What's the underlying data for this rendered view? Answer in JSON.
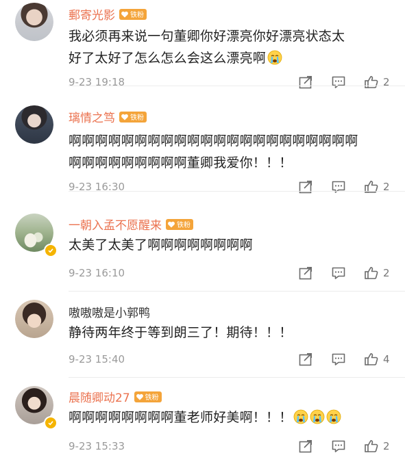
{
  "fan_badge_label": "铁粉",
  "comments": [
    {
      "username": "郵寄光影",
      "has_badge": true,
      "lines": [
        "我必须再来说一句董卿你好漂亮你好漂亮状态太",
        "好了太好了怎么怎么会这么漂亮啊"
      ],
      "emoji": [
        "crying-face-icon"
      ],
      "timestamp": "9-23 19:18",
      "likes": "2"
    },
    {
      "username": "璃情之笃",
      "has_badge": true,
      "lines": [
        "啊啊啊啊啊啊啊啊啊啊啊啊啊啊啊啊啊啊啊啊啊啊",
        "啊啊啊啊啊啊啊啊啊董卿我爱你！！！"
      ],
      "emoji": [],
      "timestamp": "9-23 16:30",
      "likes": "2"
    },
    {
      "username": "一朝入孟不愿醒来",
      "has_badge": true,
      "lines": [
        "太美了太美了啊啊啊啊啊啊啊啊"
      ],
      "emoji": [],
      "timestamp": "9-23 16:10",
      "likes": "2"
    },
    {
      "username": "嗷嗷嗷是小郭鸭",
      "has_badge": false,
      "lines": [
        "静待两年终于等到朗三了！期待！！！"
      ],
      "emoji": [],
      "timestamp": "9-23 15:40",
      "likes": "4"
    },
    {
      "username": "晨随卿动27",
      "has_badge": true,
      "lines": [
        "啊啊啊啊啊啊啊啊董老师好美啊！！！"
      ],
      "emoji": [
        "crying-face-icon",
        "crying-face-icon",
        "crying-face-icon"
      ],
      "timestamp": "9-23 15:33",
      "likes": "2"
    }
  ],
  "colors": {
    "username": "#eb7350",
    "badge": "#f4a43a",
    "verify": "#f5b400",
    "text": "#222222",
    "meta": "#9a9a9a"
  }
}
